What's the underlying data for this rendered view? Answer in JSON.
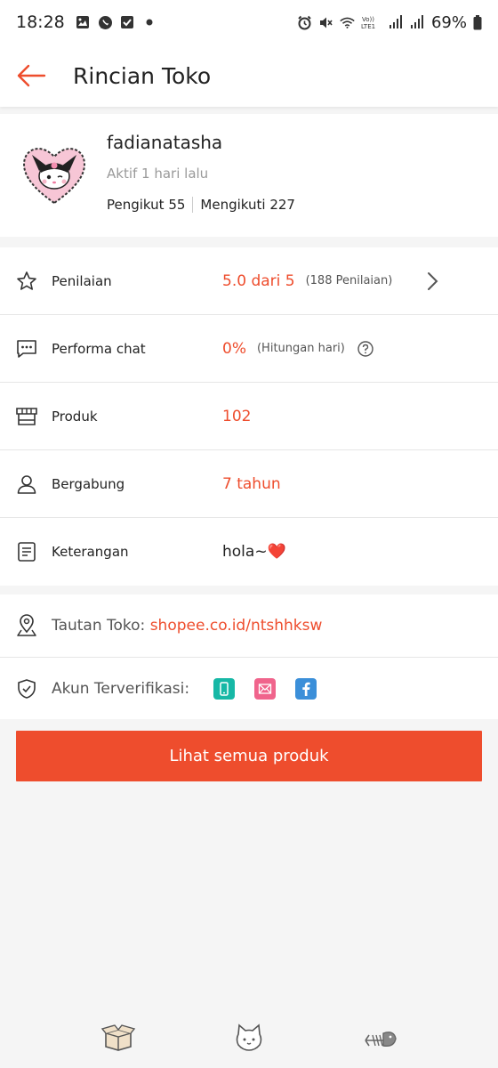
{
  "status_bar": {
    "time": "18:28",
    "battery": "69%",
    "icons_left": [
      "gallery-icon",
      "whatsapp-icon",
      "checkbox-notification-icon",
      "dot-icon"
    ],
    "icons_right": [
      "alarm-icon",
      "mute-icon",
      "wifi-icon",
      "volte-icon",
      "signal-icon",
      "signal-icon",
      "battery-icon"
    ]
  },
  "header": {
    "title": "Rincian Toko",
    "back_icon": "arrow-left-icon"
  },
  "profile": {
    "name": "fadianatasha",
    "active": "Aktif 1 hari lalu",
    "followers": "Pengikut 55",
    "following": "Mengikuti 227"
  },
  "stats": {
    "rating": {
      "label": "Penilaian",
      "value": "5.0 dari 5",
      "sub": "(188 Penilaian)",
      "icon": "star-icon"
    },
    "chat": {
      "label": "Performa chat",
      "value": "0%",
      "sub": "(Hitungan hari)",
      "icon": "chat-icon"
    },
    "products": {
      "label": "Produk",
      "value": "102",
      "icon": "store-icon"
    },
    "joined": {
      "label": "Bergabung",
      "value": "7 tahun",
      "icon": "user-icon"
    },
    "description": {
      "label": "Keterangan",
      "value": "hola~❤️",
      "icon": "document-icon"
    }
  },
  "links": {
    "shop_link_label": "Tautan Toko: ",
    "shop_link_url": "shopee.co.id/ntshhksw",
    "verified_label": "Akun Terverifikasi:",
    "verified_badges": [
      "phone-icon",
      "email-icon",
      "facebook-icon"
    ]
  },
  "cta": {
    "label": "Lihat semua produk"
  },
  "bottom_nav": [
    "box-icon",
    "cat-icon",
    "fishbone-icon"
  ],
  "colors": {
    "accent": "#ee4d2d",
    "phone_badge": "#17b8a6",
    "email_badge": "#f0648c",
    "facebook_badge": "#3b8fd9"
  }
}
